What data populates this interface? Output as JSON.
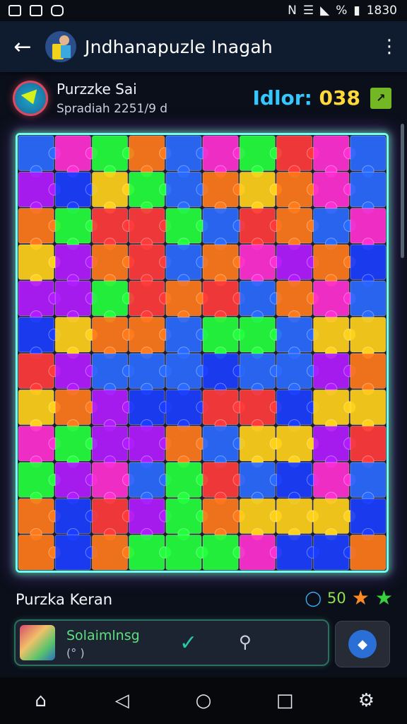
{
  "status_bar": {
    "time": "1830",
    "battery": "%",
    "signal_icons": [
      "nfc-icon",
      "wifi-icon",
      "signal-icon",
      "battery-icon"
    ]
  },
  "app_bar": {
    "title": "Jndhanapuzle Inagah",
    "back_icon": "arrow-left-icon",
    "menu_icon": "more-vertical-icon"
  },
  "puzzle_info": {
    "name": "Purzzke Sai",
    "subtitle": "Spradiah 2251/9 d",
    "score_label": "Idlor:",
    "score_value": "038"
  },
  "board": {
    "cols": 10,
    "rows": 12,
    "palette": [
      "#22ff3c",
      "#ff7a1a",
      "#b11cff",
      "#2a6bff",
      "#ff2fd2",
      "#ffd21a",
      "#1a3dff",
      "#ff3a3a"
    ]
  },
  "section": {
    "title": "Purzka Keran",
    "pieces_value": "50",
    "star_colors": [
      "#ff8a22",
      "#37d23c"
    ]
  },
  "bottom_card": {
    "title": "Solaimlnsg",
    "subtitle": "(° )"
  },
  "colors": {
    "accent": "#33c8ff",
    "score": "#ffd93a",
    "glow": "#6dfff0"
  }
}
